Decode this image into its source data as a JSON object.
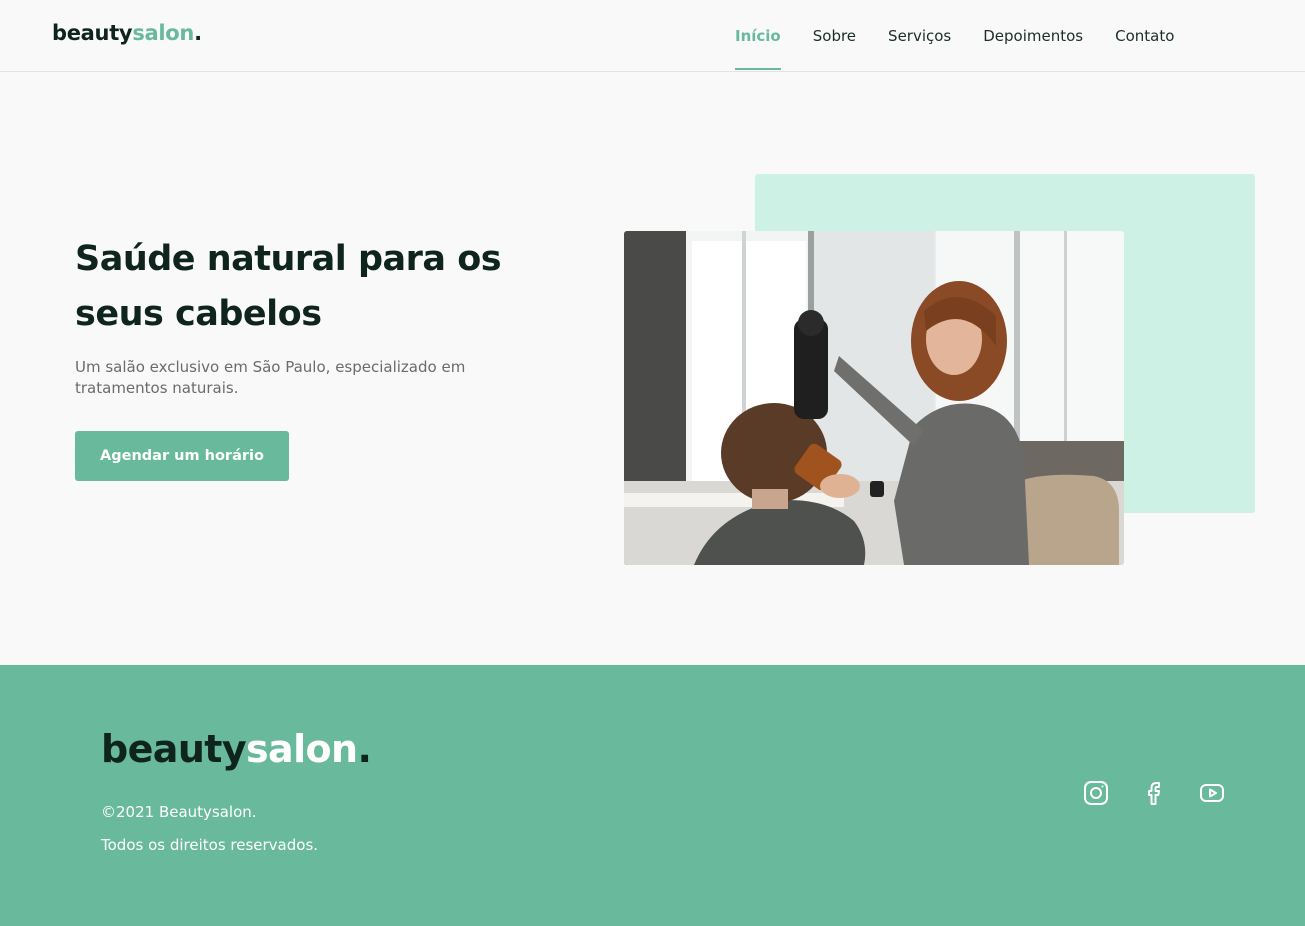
{
  "header": {
    "logo": {
      "part1": "beauty",
      "part2": "salon",
      "part3": "."
    },
    "nav": [
      {
        "label": "Início",
        "active": true
      },
      {
        "label": "Sobre"
      },
      {
        "label": "Serviços"
      },
      {
        "label": "Depoimentos"
      },
      {
        "label": "Contato"
      }
    ]
  },
  "hero": {
    "title": "Saúde natural para os seus cabelos",
    "text": "Um salão exclusivo em São Paulo, especializado em tratamentos naturais.",
    "cta": "Agendar um horário",
    "image_icon": "salon-hairdresser-photo"
  },
  "footer": {
    "logo": {
      "part1": "beauty",
      "part2": "salon",
      "part3": "."
    },
    "copyright": "©2021 Beautysalon.",
    "rights": "Todos os direitos reservados.",
    "social_icons": [
      "instagram-icon",
      "facebook-icon",
      "youtube-icon"
    ]
  },
  "colors": {
    "accent": "#69b99d",
    "accent_light": "#cdf1e4",
    "dark": "#0f241d",
    "background": "#f9f9f9"
  }
}
